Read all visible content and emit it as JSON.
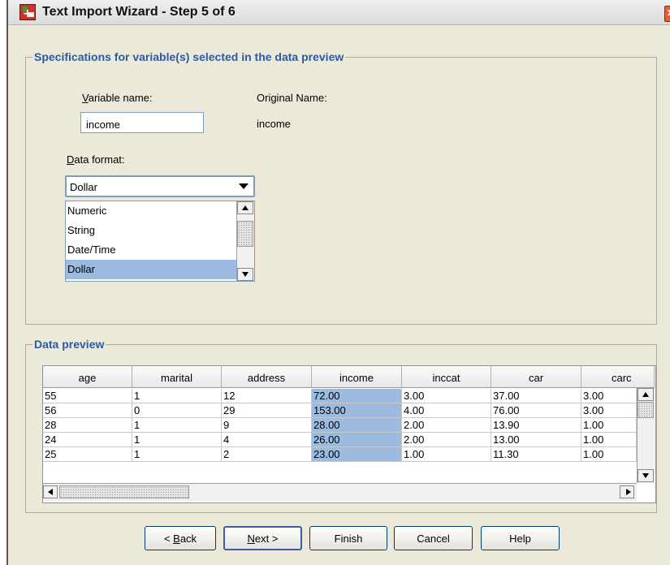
{
  "window": {
    "title": "Text Import Wizard - Step 5 of 6",
    "icon": "spss-data-icon",
    "close_glyph": "✕"
  },
  "specifications": {
    "group_label": "Specifications for variable(s) selected in the data preview",
    "variable_name_label_mnemonic": "V",
    "variable_name_label_rest": "ariable name:",
    "variable_name_value": "income",
    "original_name_label": "Original Name:",
    "original_name_value": "income",
    "data_format_label_mnemonic": "D",
    "data_format_label_rest": "ata format:",
    "data_format_selected": "Dollar",
    "data_format_options": [
      "Numeric",
      "String",
      "Date/Time",
      "Dollar"
    ],
    "selected_index": 3
  },
  "preview": {
    "group_label": "Data preview",
    "columns": [
      "age",
      "marital",
      "address",
      "income",
      "inccat",
      "car",
      "carc"
    ],
    "selected_column": 3,
    "rows": [
      [
        "55",
        "1",
        "12",
        "72.00",
        "3.00",
        "37.00",
        "3.00"
      ],
      [
        "56",
        "0",
        "29",
        "153.00",
        "4.00",
        "76.00",
        "3.00"
      ],
      [
        "28",
        "1",
        "9",
        "28.00",
        "2.00",
        "13.90",
        "1.00"
      ],
      [
        "24",
        "1",
        "4",
        "26.00",
        "2.00",
        "13.00",
        "1.00"
      ],
      [
        "25",
        "1",
        "2",
        "23.00",
        "1.00",
        "11.30",
        "1.00"
      ]
    ]
  },
  "buttons": {
    "back": {
      "before": "< ",
      "mnemonic": "B",
      "after": "ack"
    },
    "next": {
      "before": "",
      "mnemonic": "N",
      "after": "ext >"
    },
    "finish": "Finish",
    "cancel": "Cancel",
    "help": "Help"
  },
  "colors": {
    "selection": "#9bbbe0",
    "group_label": "#2d5ba3",
    "dialog_background": "#ece9d8"
  }
}
